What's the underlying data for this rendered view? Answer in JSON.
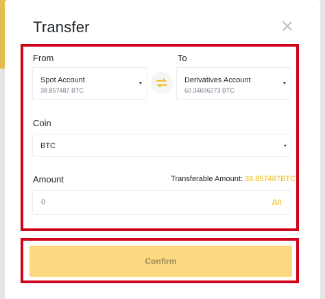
{
  "modal": {
    "title": "Transfer",
    "from": {
      "label": "From",
      "account": "Spot Account",
      "balance": "38.857487 BTC"
    },
    "to": {
      "label": "To",
      "account": "Derivatives Account",
      "balance": "60.34696273 BTC"
    },
    "coin": {
      "label": "Coin",
      "selected": "BTC"
    },
    "amount": {
      "label": "Amount",
      "transferable_label": "Transferable Amount:",
      "transferable_value": "38.857487BTC",
      "value": "0",
      "all_label": "All"
    },
    "confirm_label": "Confirm"
  },
  "colors": {
    "accent": "#f0b90b",
    "confirm_bg": "#fcd981",
    "highlight": "#d0021b"
  },
  "icons": {
    "close": "close-icon",
    "swap": "swap-arrows-icon",
    "caret": "caret-down-icon"
  }
}
